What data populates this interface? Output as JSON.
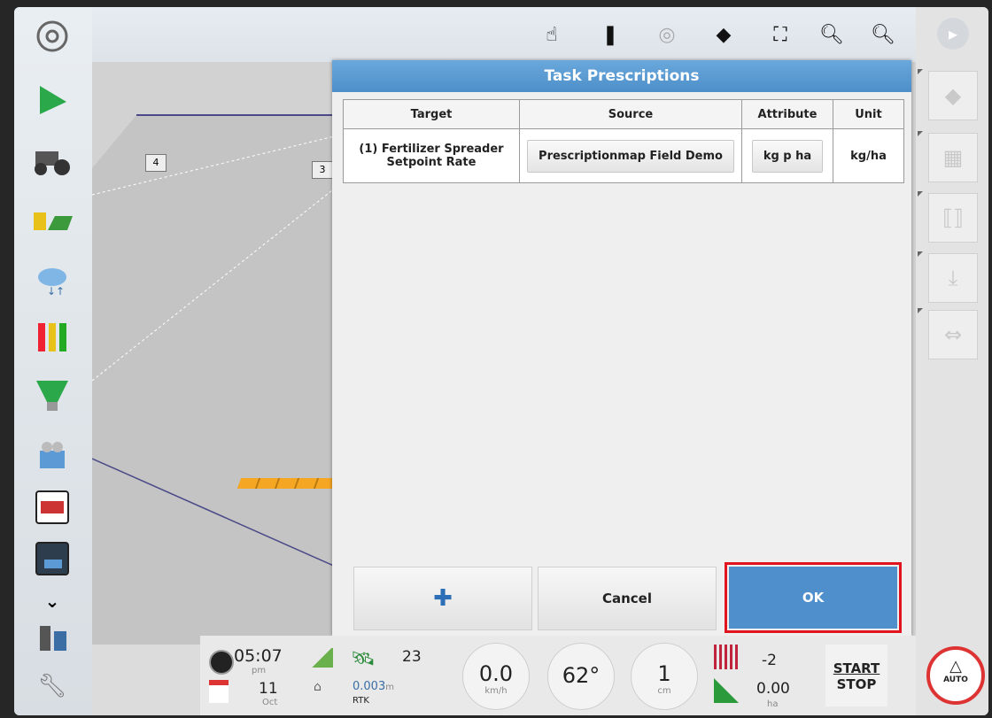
{
  "dialog": {
    "title": "Task Prescriptions",
    "columns": [
      "Target",
      "Source",
      "Attribute",
      "Unit"
    ],
    "rows": [
      {
        "target_line1": "(1) Fertilizer Spreader",
        "target_line2": "Setpoint Rate",
        "source": "Prescriptionmap Field Demo",
        "attribute": "kg p ha",
        "unit": "kg/ha"
      }
    ],
    "add_symbol": "✚",
    "cancel_label": "Cancel",
    "ok_label": "OK"
  },
  "map": {
    "marker_1": "4",
    "marker_2": "3"
  },
  "status": {
    "time": "05:07",
    "time_period": "pm",
    "date_day": "11",
    "date_month": "Oct",
    "satellites": "23",
    "accuracy": "0.003",
    "accuracy_unit": "m",
    "correction": "RTK",
    "speed": "0.0",
    "speed_unit": "km/h",
    "heading": "62°",
    "offset": "1",
    "offset_unit": "cm",
    "count": "-2",
    "area": "0.00",
    "area_unit": "ha",
    "start_label": "START",
    "stop_label": "STOP",
    "auto_label": "AUTO"
  },
  "colors": {
    "dialog_header": "#4d8fc9",
    "ok_button": "#4f8fcb",
    "highlight": "#e0141e",
    "implement": "#f5a623"
  }
}
